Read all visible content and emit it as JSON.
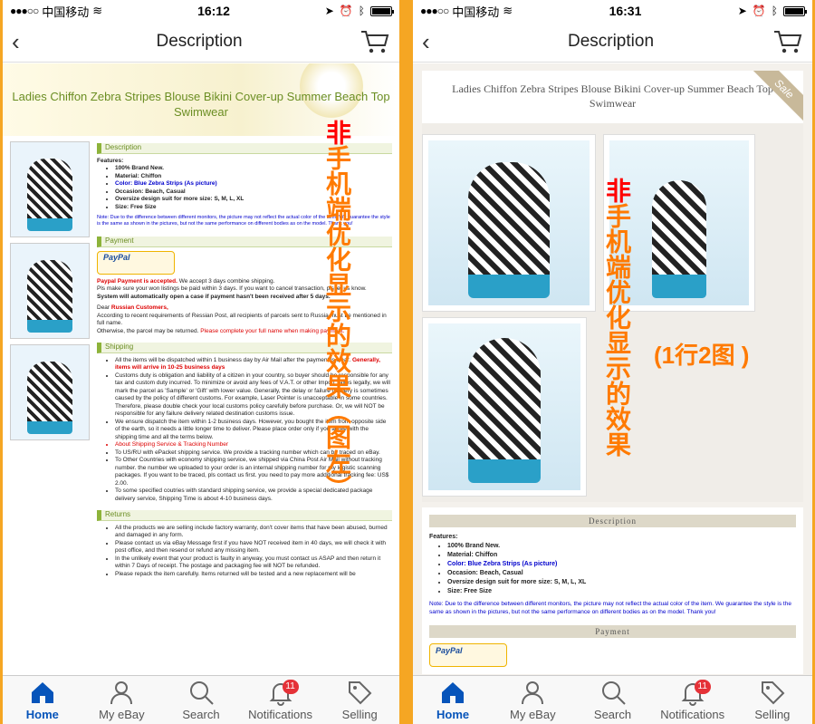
{
  "colors": {
    "accent": "#f5a623",
    "ebay_blue": "#0654ba",
    "badge_red": "#e53238",
    "overlay_orange": "#ff7a00"
  },
  "left": {
    "status": {
      "carrier": "中国移动",
      "time": "16:12"
    },
    "nav": {
      "title": "Description"
    },
    "listing_title": "Ladies Chiffon Zebra Stripes Blouse Bikini Cover-up Summer Beach Top Swimwear",
    "sections": {
      "description": "Description",
      "features_label": "Features:",
      "features": [
        "100% Brand New.",
        "Material: Chiffon",
        "Color: Blue Zebra Strips (As picture)",
        "Occasion: Beach, Casual",
        "Oversize design suit for more size: S, M, L, XL",
        "Size: Free Size"
      ],
      "note": "Note: Due to the difference between different monitors, the picture may not reflect the actual color of the item. We guarantee the style is the same as shown in the pictures, but not the same performance on different bodies as on the model. Thank you!",
      "payment": "Payment",
      "paypal": "PayPal",
      "payment_accepted": "Paypal Payment is accepted.",
      "payment_text1": "We accept 3 days combine shipping.",
      "payment_text2": "Pls make sure your won listings be paid within 3 days. If you want to cancel transaction, pls let us know.",
      "payment_text3": "System will automatically open a case if payment hasn't been received after 5 days.",
      "dear": "Dear",
      "russian": "Russian Customers,",
      "russian_text": "According to recent requirements of Ressian Post, all recipients of parcels sent to Russia must be mentioned in full name.",
      "otherwise": "Otherwise, the parcel may be returned.",
      "complete_name": "Please complete your full name when making payment.",
      "shipping": "Shipping",
      "ship1": "All the items will be dispatched within 1 business day by Air Mail after the payment is clear.",
      "ship_generally": "Generally, items will arrive in 10-25 business days",
      "ship2": "Customs duty is obligation and liability of a citizen in your country, so buyer should be responsible for any tax and custom duty incurred. To minimize or avoid any fees of V.A.T. or other Import Taxes legally, we will mark the parcel as 'Sample' or 'Gift' with lower value. Generally, the delay or failure delivery is sometimes caused by the policy of different customs. For example, Laser Pointer is unacceptable in some countries. Therefore, please double check your local customs policy carefully before purchase. Or, we will NOT be responsible for any failure delivery related destination customs issue.",
      "ship3": "We ensure dispatch the item within 1-2 business days. However, you bought the item from opposite side of the earth, so it needs a little longer time to deliver. Please place order only if you agree with the shipping time and all the terms below.",
      "ship_about": "About Shipping Service & Tracking Number",
      "ship4": "To US/RU with ePacket shipping service. We provide a tracking number which can be traced on eBay.",
      "ship5": "To Other Countries with economy shipping service, we shipped via China Post Air Mail without tracking number. the number we uploaded to your order is an internal shipping number for my logistic scanning packages. If you want to be traced, pls contact us first. you need to pay more additional tracking fee: US$ 2.00.",
      "ship6": "To some specified coutries with standard shipping service, we provide a special dedicated package delivery service, Shipping Time is about 4-10 business days.",
      "returns": "Returns",
      "ret1": "All the products we are selling include factory warranty, don't cover items that have been abused, burned and damaged in any form.",
      "ret2": "Please contact us via eBay Message first if you have NOT received item in 40 days, we will check it with post office, and then resend or refund any missing item.",
      "ret3": "In the unlikely event that your product is faulty in anyway, you must contact us ASAP and then return it within 7 Days of receipt. The postage and packaging fee will NOT be refunded.",
      "ret4": "Please repack the item carefully. Items returned will be tested and a new replacement will be"
    },
    "overlay_first": "非",
    "overlay_rest": "手机端优化显示的效果（图左）"
  },
  "right": {
    "status": {
      "carrier": "中国移动",
      "time": "16:31"
    },
    "nav": {
      "title": "Description"
    },
    "listing_title": "Ladies Chiffon Zebra Stripes Blouse Bikini Cover-up Summer Beach Top Swimwear",
    "sale": "Sale",
    "overlay_first": "非",
    "overlay_rest": "手机端优化显示的效果",
    "overlay_note": "(1行2图 )",
    "sections": {
      "description": "Description",
      "features_label": "Features:",
      "features": [
        "100% Brand New.",
        "Material: Chiffon",
        "Color: Blue Zebra Strips (As picture)",
        "Occasion: Beach, Casual",
        "Oversize design suit for more size: S, M, L, XL",
        "Size: Free Size"
      ],
      "note": "Note: Due to the difference between different monitors, the picture may not reflect the actual color of the item. We guarantee the style is the same as shown in the pictures, but not the same performance on different bodies as on the model. Thank you!",
      "payment": "Payment",
      "paypal": "PayPal"
    }
  },
  "tabs": [
    {
      "label": "Home",
      "icon": "home-icon",
      "active": true
    },
    {
      "label": "My eBay",
      "icon": "person-icon",
      "active": false
    },
    {
      "label": "Search",
      "icon": "search-icon",
      "active": false
    },
    {
      "label": "Notifications",
      "icon": "bell-icon",
      "active": false,
      "badge": "11"
    },
    {
      "label": "Selling",
      "icon": "tag-icon",
      "active": false
    }
  ]
}
